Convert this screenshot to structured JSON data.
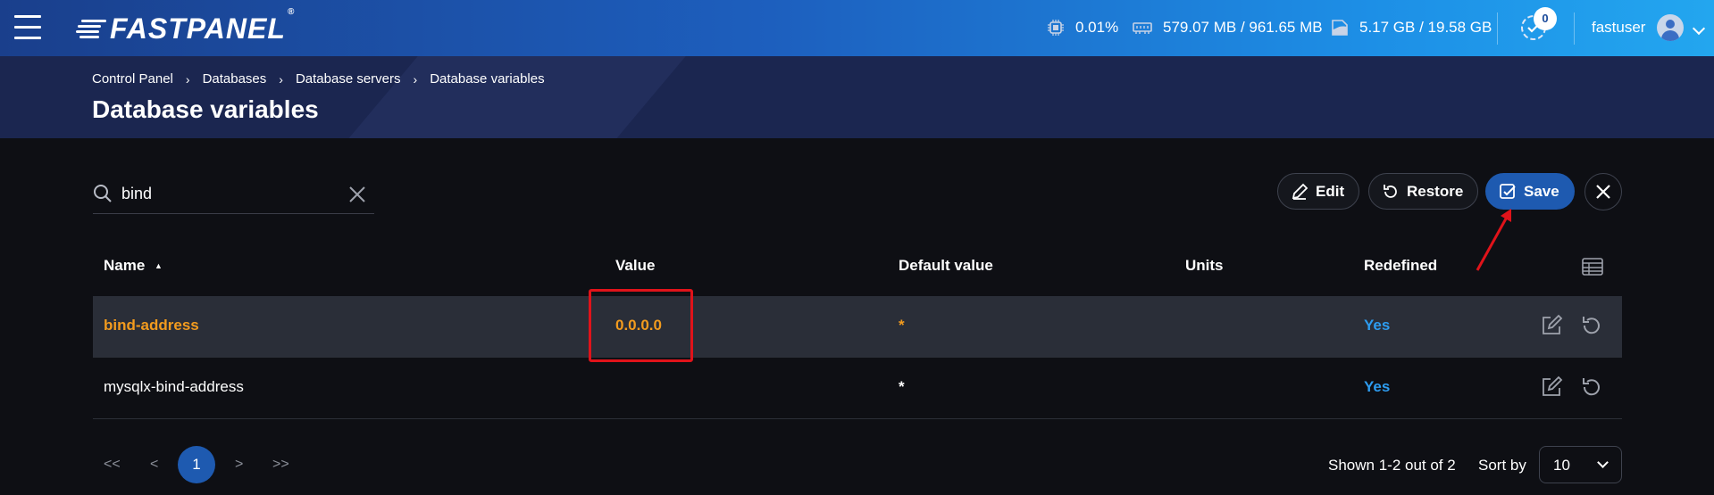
{
  "app": {
    "logo_text": "FASTPANEL",
    "logo_reg": "®"
  },
  "stats": {
    "cpu": "0.01%",
    "memory": "579.07 MB / 961.65 MB",
    "disk": "5.17 GB / 19.58 GB"
  },
  "tasks": {
    "count": "0"
  },
  "user": {
    "name": "fastuser"
  },
  "breadcrumb": [
    "Control Panel",
    "Databases",
    "Database servers",
    "Database variables"
  ],
  "page_title": "Database variables",
  "search": {
    "value": "bind",
    "placeholder": ""
  },
  "actions": {
    "edit": "Edit",
    "restore": "Restore",
    "save": "Save"
  },
  "table": {
    "columns": {
      "name": "Name",
      "value": "Value",
      "default": "Default value",
      "units": "Units",
      "redefined": "Redefined"
    },
    "sort_indicator": "▲",
    "rows": [
      {
        "name": "bind-address",
        "value": "0.0.0.0",
        "default": "*",
        "units": "",
        "redefined": "Yes"
      },
      {
        "name": "mysqlx-bind-address",
        "value": "",
        "default": "*",
        "units": "",
        "redefined": "Yes"
      }
    ]
  },
  "pagination": {
    "first": "<<",
    "prev": "<",
    "current": "1",
    "next": ">",
    "last": ">>"
  },
  "shown": "Shown 1-2 out of 2",
  "sort_by": {
    "label": "Sort by",
    "value": "10"
  },
  "colors": {
    "accent": "#1e5ab0",
    "highlight": "#f29b1e",
    "link": "#2d9cf0",
    "annotation": "#e0131a"
  }
}
